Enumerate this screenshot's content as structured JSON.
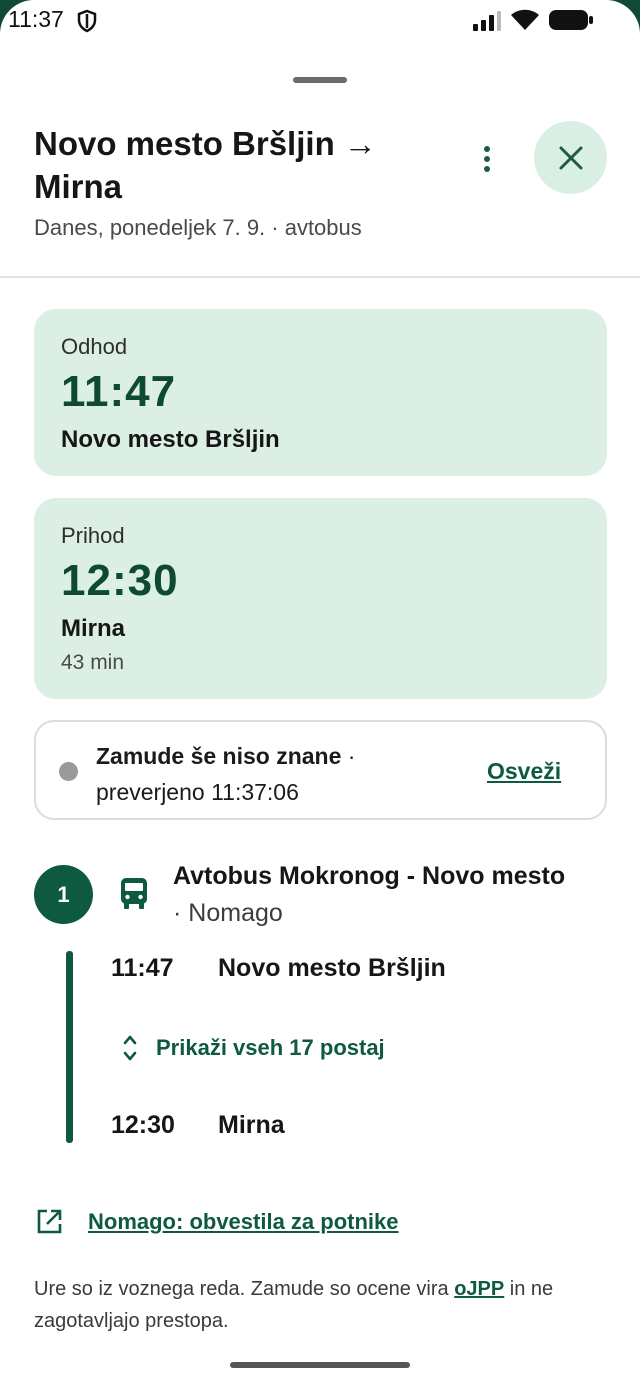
{
  "status_bar": {
    "time": "11:37"
  },
  "header": {
    "title": "Novo mesto Bršljin → Mirna",
    "subtitle": "Danes, ponedeljek 7. 9. · avtobus"
  },
  "departure": {
    "label": "Odhod",
    "time": "11:47",
    "place": "Novo mesto Bršljin"
  },
  "arrival": {
    "label": "Prihod",
    "time": "12:30",
    "place": "Mirna",
    "duration": "43 min"
  },
  "delays": {
    "status": "Zamude še niso znane",
    "separator": " · ",
    "checked": "preverjeno 11:37:06",
    "refresh_label": "Osveži"
  },
  "leg": {
    "number": "1",
    "route_name": "Avtobus Mokronog - Novo mesto",
    "separator": " · ",
    "operator": "Nomago",
    "stops": [
      {
        "time": "11:47",
        "name": "Novo mesto Bršljin"
      },
      {
        "time": "12:30",
        "name": "Mirna"
      }
    ],
    "show_all_label": "Prikaži vseh 17 postaj"
  },
  "notice_link": "Nomago: obvestila za potnike",
  "footer": {
    "text_before": "Ure so iz voznega reda. Zamude so ocene vira ",
    "source": "oJPP",
    "text_after": " in ne zagotavljajo prestopa."
  },
  "colors": {
    "accent": "#0e5a3e",
    "card": "#dcefe5",
    "outer": "#0f4a34"
  },
  "icons": [
    "shield-icon",
    "signal-icon",
    "wifi-icon",
    "battery-icon",
    "more-vert-icon",
    "close-icon",
    "bus-icon",
    "expand-icon",
    "open-external-icon"
  ]
}
